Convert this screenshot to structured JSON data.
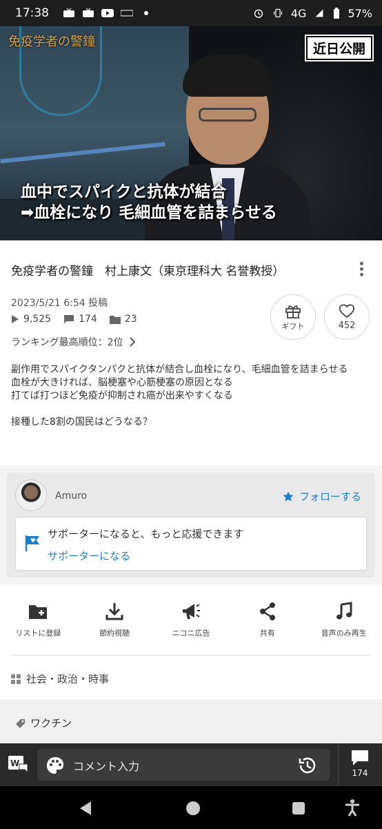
{
  "status_bar": {
    "time": "17:38",
    "network": "4G",
    "battery": "57%",
    "icons": [
      "tv-icon",
      "tv-icon",
      "youtube-icon",
      "nitori-icon",
      "dot-icon",
      "alarm-icon",
      "vibrate-icon",
      "signal-icon",
      "battery-icon"
    ]
  },
  "video": {
    "brand": "免疫学者の警鐘",
    "badge": "近日公開",
    "subtitle_line1": "血中でスパイクと抗体が結合",
    "subtitle_line2": "➡血栓になり 毛細血管を詰まらせる"
  },
  "info": {
    "title": "免疫学者の警鐘　村上康文（東京理科大 名誉教授）",
    "posted": "2023/5/21 6:54 投稿",
    "views": "9,525",
    "comments": "174",
    "mylists": "23",
    "ranking": "ランキング最高順位：2位",
    "gift_label": "ギフト",
    "like_count": "452",
    "description": "副作用でスパイクタンパクと抗体が結合し血栓になり、毛細血管を詰まらせる\n血栓が大きければ、脳梗塞や心筋梗塞の原因となる\n打てば打つほど免疫が抑制され癌が出来やすくなる\n\n接種した8割の国民はどうなる？"
  },
  "uploader": {
    "name": "Amuro",
    "follow_label": "フォローする",
    "support_text": "サポーターになると、もっと応援できます",
    "support_link": "サポーターになる"
  },
  "actions": [
    {
      "label": "リストに登録",
      "icon": "playlist-add-icon"
    },
    {
      "label": "節約視聴",
      "icon": "download-icon"
    },
    {
      "label": "ニコニ広告",
      "icon": "megaphone-icon"
    },
    {
      "label": "共有",
      "icon": "share-icon"
    },
    {
      "label": "音声のみ再生",
      "icon": "music-note-icon"
    }
  ],
  "category": "社会・政治・時事",
  "tag": "ワクチン",
  "comment_bar": {
    "placeholder": "コメント入力",
    "count": "174"
  },
  "colors": {
    "accent": "#1a7fd1",
    "dark_bar": "#2a2a2a"
  }
}
